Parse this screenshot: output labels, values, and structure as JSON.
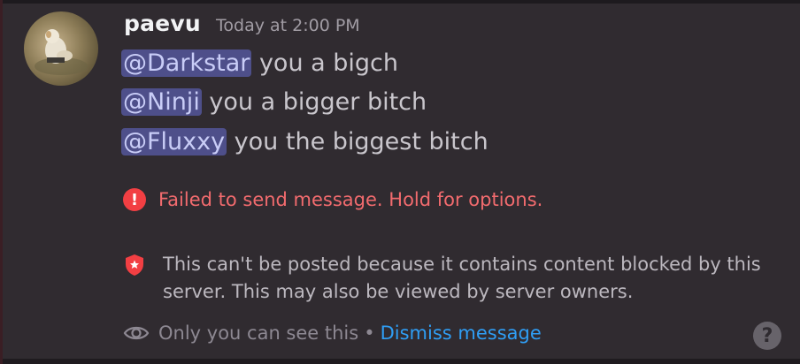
{
  "message": {
    "username": "paevu",
    "timestamp": "Today at 2:00 PM",
    "lines": [
      {
        "mention": "@Darkstar",
        "text": " you a bigch"
      },
      {
        "mention": "@Ninji",
        "text": " you a bigger bitch"
      },
      {
        "mention": "@Fluxxy",
        "text": " you the biggest bitch"
      }
    ]
  },
  "error": {
    "icon": "exclamation-icon",
    "glyph": "!",
    "text": "Failed to send message. Hold for options."
  },
  "notice": {
    "icon": "shield-star-icon",
    "text": "This can't be posted because it contains content blocked by this server. This may also be viewed by server owners."
  },
  "footer": {
    "icon": "eye-icon",
    "visibility_text": "Only you can see this",
    "separator": "•",
    "dismiss_label": "Dismiss message"
  },
  "help": {
    "icon": "help-icon",
    "glyph": "?"
  },
  "colors": {
    "background": "#302b30",
    "mention_bg": "#4e4f8a",
    "error_red": "#f23f43",
    "link_blue": "#2f9ef5"
  }
}
